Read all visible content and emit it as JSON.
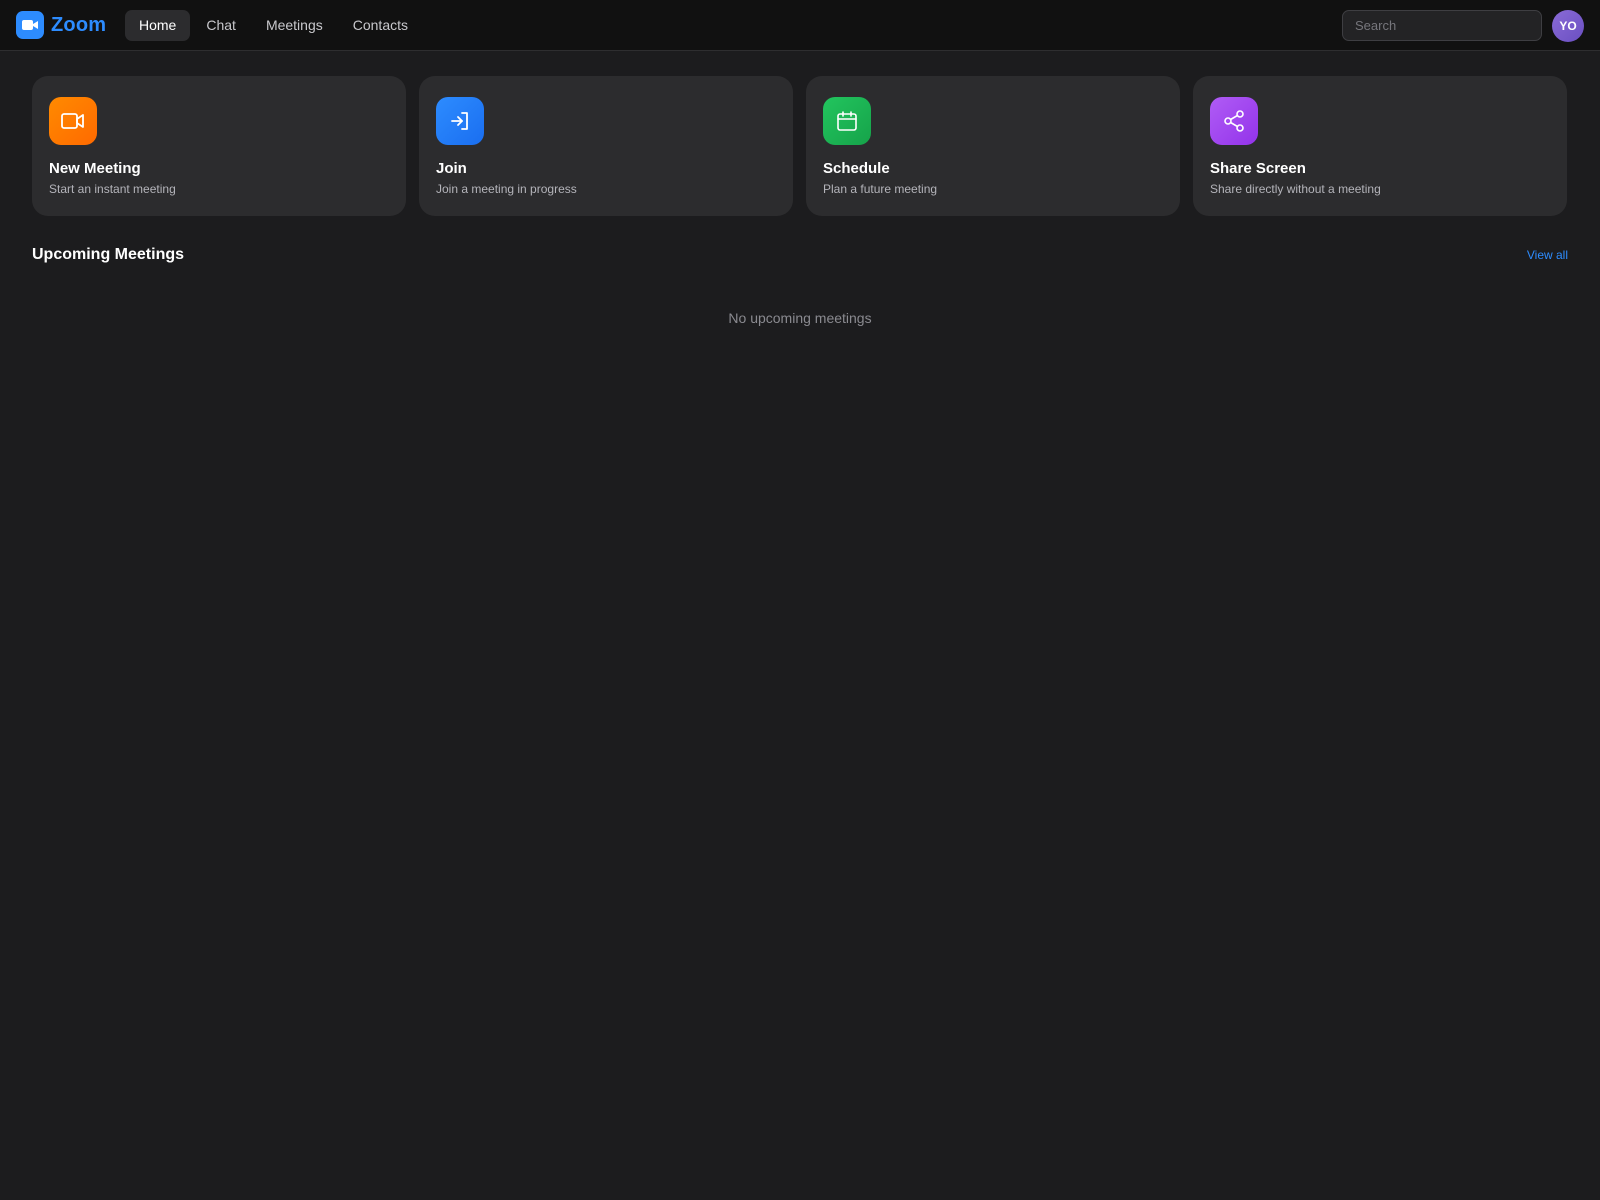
{
  "app": {
    "name": "Zoom",
    "accent_color": "#2d8cff"
  },
  "nav": {
    "items": [
      {
        "label": "Home",
        "active": true
      },
      {
        "label": "Chat",
        "active": false
      },
      {
        "label": "Meetings",
        "active": false
      },
      {
        "label": "Contacts",
        "active": false
      }
    ]
  },
  "search": {
    "placeholder": "Search",
    "value": ""
  },
  "user": {
    "initials": "YO"
  },
  "actions": [
    {
      "title": "New Meeting",
      "subtitle": "Start an instant meeting",
      "icon": "video-camera-icon",
      "color": "#ff7a00"
    },
    {
      "title": "Join",
      "subtitle": "Join a meeting in progress",
      "icon": "enter-icon",
      "color": "#2d8cff"
    },
    {
      "title": "Schedule",
      "subtitle": "Plan a future meeting",
      "icon": "calendar-icon",
      "color": "#22c55e"
    },
    {
      "title": "Share Screen",
      "subtitle": "Share directly without a meeting",
      "icon": "share-icon",
      "color": "#a855f7"
    }
  ],
  "upcoming": {
    "title": "Upcoming Meetings",
    "view_all_label": "View all",
    "empty_text": "No upcoming meetings"
  }
}
